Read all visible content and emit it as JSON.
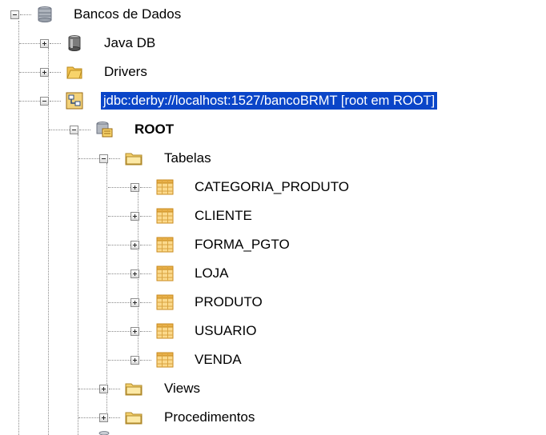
{
  "tree": {
    "root": {
      "label": "Bancos de Dados",
      "icon": "database-folder-icon"
    },
    "java_db": {
      "label": "Java DB",
      "icon": "database-icon"
    },
    "drivers": {
      "label": "Drivers",
      "icon": "folder-icon"
    },
    "connection": {
      "label": "jdbc:derby://localhost:1527/bancoBRMT [root em ROOT]",
      "icon": "connection-icon",
      "selected": true
    },
    "schema": {
      "label": "ROOT",
      "icon": "schema-icon"
    },
    "tabelas": {
      "label": "Tabelas",
      "icon": "folder-open-icon"
    },
    "tables": [
      {
        "label": "CATEGORIA_PRODUTO"
      },
      {
        "label": "CLIENTE"
      },
      {
        "label": "FORMA_PGTO"
      },
      {
        "label": "LOJA"
      },
      {
        "label": "PRODUTO"
      },
      {
        "label": "USUARIO"
      },
      {
        "label": "VENDA"
      }
    ],
    "views": {
      "label": "Views",
      "icon": "folder-icon"
    },
    "procedimentos": {
      "label": "Procedimentos",
      "icon": "folder-icon"
    }
  },
  "colors": {
    "selection": "#0a45c8",
    "folder": "#f7d36a",
    "table": "#e8b04a"
  }
}
